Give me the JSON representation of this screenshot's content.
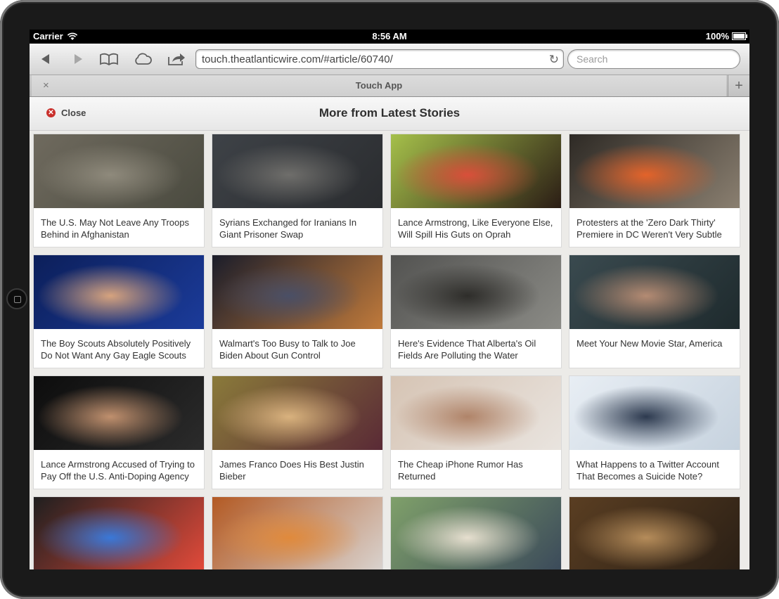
{
  "status": {
    "carrier": "Carrier",
    "time": "8:56 AM",
    "battery": "100%"
  },
  "browser": {
    "url": "touch.theatlanticwire.com/#article/60740/",
    "search_placeholder": "Search",
    "tab_title": "Touch App",
    "tab_close": "×",
    "new_tab": "+",
    "icons": [
      "back-icon",
      "forward-icon",
      "bookmarks-icon",
      "cloud-icon",
      "share-icon",
      "reload-icon"
    ]
  },
  "page": {
    "close_label": "Close",
    "title": "More from Latest Stories"
  },
  "stories": [
    {
      "title": "The U.S. May Not Leave Any Troops Behind in Afghanistan",
      "colors": [
        "#6f6a5e",
        "#8f8a7c",
        "#4a4a3f"
      ]
    },
    {
      "title": "Syrians Exchanged for Iranians In Giant Prisoner Swap",
      "colors": [
        "#3e4247",
        "#6f6e6b",
        "#2a2c2f"
      ]
    },
    {
      "title": "Lance Armstrong, Like Everyone Else, Will Spill His Guts on Oprah",
      "colors": [
        "#a5c04a",
        "#d94f3a",
        "#2b1d15"
      ]
    },
    {
      "title": "Protesters at the 'Zero Dark Thirty' Premiere in DC Weren't Very Subtle",
      "colors": [
        "#2e2a25",
        "#e3632a",
        "#8a7f70"
      ]
    },
    {
      "title": "The Boy Scouts Absolutely Positively Do Not Want Any Gay Eagle Scouts",
      "colors": [
        "#0c1f5a",
        "#d6a37e",
        "#1b3b9a"
      ]
    },
    {
      "title": "Walmart's Too Busy to Talk to Joe Biden About Gun Control",
      "colors": [
        "#1b1d2a",
        "#4a4f66",
        "#c07a3b"
      ]
    },
    {
      "title": "Here's Evidence That Alberta's Oil Fields Are Polluting the Water",
      "colors": [
        "#535351",
        "#2e2d2a",
        "#8b8b86"
      ]
    },
    {
      "title": "Meet Your New Movie Star, America",
      "colors": [
        "#3a4a4f",
        "#b48b73",
        "#1e2a2d"
      ]
    },
    {
      "title": "Lance Armstrong Accused of Trying to Pay Off the U.S. Anti-Doping Agency",
      "colors": [
        "#0d0d0d",
        "#c0906e",
        "#2b2b2b"
      ]
    },
    {
      "title": "James Franco Does His Best Justin Bieber",
      "colors": [
        "#8a7a3a",
        "#d9b27e",
        "#5a2a36"
      ]
    },
    {
      "title": "The Cheap iPhone Rumor Has Returned",
      "colors": [
        "#d6c4b4",
        "#b08469",
        "#e9e4df"
      ]
    },
    {
      "title": "What Happens to a Twitter Account That Becomes a Suicide Note?",
      "colors": [
        "#e8eef4",
        "#2d3a4f",
        "#c6d2de"
      ]
    },
    {
      "title": "",
      "colors": [
        "#1f1f1f",
        "#3a78d8",
        "#e24a3a"
      ]
    },
    {
      "title": "",
      "colors": [
        "#b35a24",
        "#e08a3c",
        "#d9d3cf"
      ]
    },
    {
      "title": "",
      "colors": [
        "#7fa06a",
        "#e6dfcf",
        "#3b4a5a"
      ]
    },
    {
      "title": "",
      "colors": [
        "#5a3e22",
        "#b58c5a",
        "#2a1f15"
      ]
    }
  ]
}
